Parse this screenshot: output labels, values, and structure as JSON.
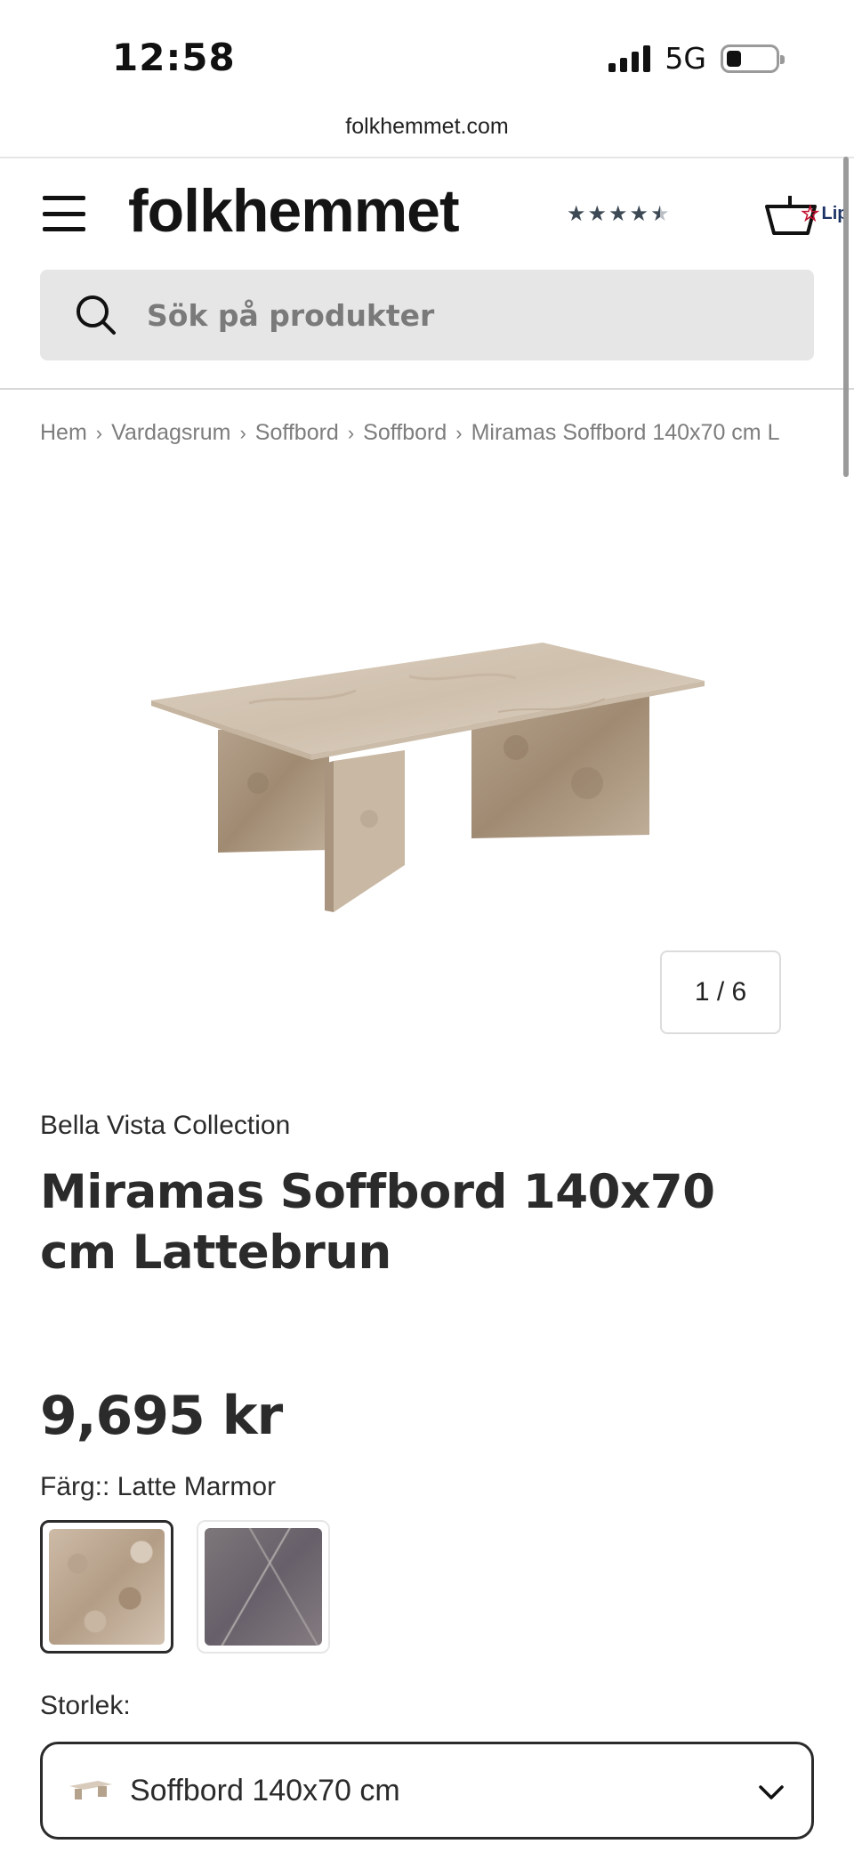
{
  "status_bar": {
    "time": "12:58",
    "network": "5G"
  },
  "browser": {
    "url": "folkhemmet.com"
  },
  "header": {
    "logo": "folkhemmet",
    "rating_stars": 4.5,
    "partner_badge": "Lip",
    "search": {
      "placeholder": "Sök på produkter"
    }
  },
  "breadcrumb": {
    "items": [
      "Hem",
      "Vardagsrum",
      "Soffbord",
      "Soffbord",
      "Miramas Soffbord 140x70 cm L"
    ],
    "separator": "›"
  },
  "gallery": {
    "counter": "1 / 6"
  },
  "product": {
    "brand": "Bella Vista Collection",
    "title": "Miramas Soffbord 140x70 cm Lattebrun",
    "price": "9,695 kr",
    "color_label": "Färg::",
    "color_value": "Latte Marmor",
    "swatches": [
      {
        "name": "latte",
        "selected": true
      },
      {
        "name": "grey",
        "selected": false
      }
    ],
    "size_label": "Storlek:",
    "size_value": "Soffbord 140x70 cm"
  },
  "colors": {
    "text": "#2b2b2b",
    "search_bg": "#e6e6e6",
    "stars": "#3d4954",
    "badge_star": "#c3122f"
  }
}
